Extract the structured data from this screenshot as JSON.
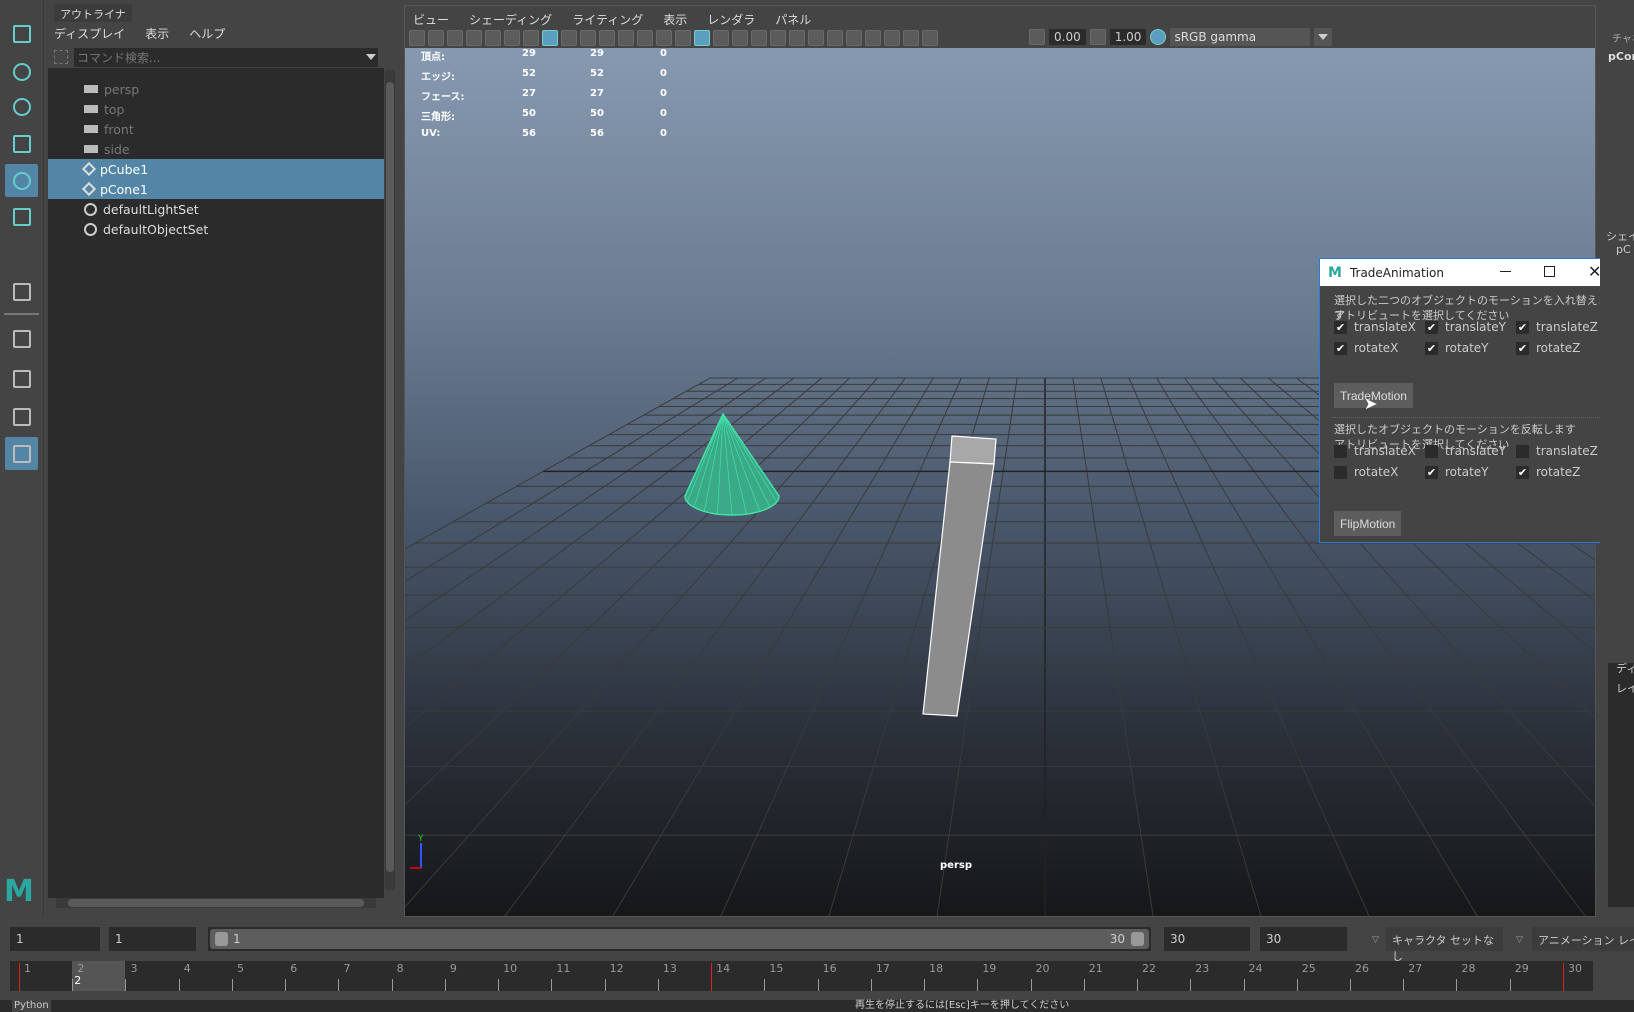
{
  "toolbox": {
    "tools": [
      "select-tool-icon",
      "lasso-tool-icon",
      "paint-select-icon",
      "move-tool-icon",
      "rotate-tool-icon",
      "scale-tool-icon",
      "curve-tool-icon",
      "single-view-layout-icon",
      "four-view-layout-icon",
      "two-view-layout-icon",
      "outliner-layout-icon"
    ],
    "active": [
      "rotate-tool-icon",
      "outliner-layout-icon"
    ]
  },
  "outliner": {
    "tab": "アウトライナ",
    "menu": [
      "ディスプレイ",
      "表示",
      "ヘルプ"
    ],
    "search_placeholder": "コマンド検索...",
    "items": [
      {
        "label": "persp",
        "type": "camera"
      },
      {
        "label": "top",
        "type": "camera"
      },
      {
        "label": "front",
        "type": "camera"
      },
      {
        "label": "side",
        "type": "camera"
      },
      {
        "label": "pCube1",
        "type": "mesh",
        "selected": true
      },
      {
        "label": "pCone1",
        "type": "mesh",
        "selected": true
      },
      {
        "label": "defaultLightSet",
        "type": "set"
      },
      {
        "label": "defaultObjectSet",
        "type": "set"
      }
    ]
  },
  "viewport": {
    "menu": [
      "ビュー",
      "シェーディング",
      "ライティング",
      "表示",
      "レンダラ",
      "パネル"
    ],
    "exposure": "0.00",
    "gamma": "1.00",
    "color_space": "sRGB gamma",
    "camera_label": "persp",
    "hud": [
      [
        "頂点:",
        "29",
        "29",
        "0"
      ],
      [
        "エッジ:",
        "52",
        "52",
        "0"
      ],
      [
        "フェース:",
        "27",
        "27",
        "0"
      ],
      [
        "三角形:",
        "50",
        "50",
        "0"
      ],
      [
        "UV:",
        "56",
        "56",
        "0"
      ]
    ],
    "accent": "#5285a6",
    "cone_color": "#44e0a8"
  },
  "dialog": {
    "title": "TradeAnimation",
    "trade_text1": "選択した二つのオブジェクトのモーションを入れ替えます",
    "trade_text2": "アトリビュートを選択してください",
    "trade_checks": [
      {
        "label": "translateX",
        "checked": true
      },
      {
        "label": "translateY",
        "checked": true
      },
      {
        "label": "translateZ",
        "checked": true
      },
      {
        "label": "rotateX",
        "checked": true
      },
      {
        "label": "rotateY",
        "checked": true
      },
      {
        "label": "rotateZ",
        "checked": true
      }
    ],
    "trade_button": "TradeMotion",
    "flip_text1": "選択したオブジェクトのモーションを反転します",
    "flip_text2": "アトリビュートを選択してください",
    "flip_checks": [
      {
        "label": "translateX",
        "checked": false
      },
      {
        "label": "translateY",
        "checked": false
      },
      {
        "label": "translateZ",
        "checked": false
      },
      {
        "label": "rotateX",
        "checked": false
      },
      {
        "label": "rotateY",
        "checked": true
      },
      {
        "label": "rotateZ",
        "checked": true
      }
    ],
    "flip_button": "FlipMotion"
  },
  "right_panel": {
    "channel_label": "チャネ",
    "object": "pCor",
    "shape_label": "シェイ",
    "shape_obj": "pC",
    "display_label": "ディ",
    "layer_label": "レイ"
  },
  "range": {
    "start": "1",
    "playback_start": "1",
    "slider_start": "1",
    "slider_end": "30",
    "playback_end": "30",
    "end": "30",
    "character_set": "キャラクタ セットなし",
    "anim_layer": "アニメーション レイヤ"
  },
  "timeline": {
    "start": 1,
    "end": 30,
    "current": 2,
    "current_label": "2",
    "keys": [
      1,
      14,
      30
    ]
  },
  "command": {
    "label": "Python",
    "help": "再生を停止するには[Esc]キーを押してください"
  }
}
